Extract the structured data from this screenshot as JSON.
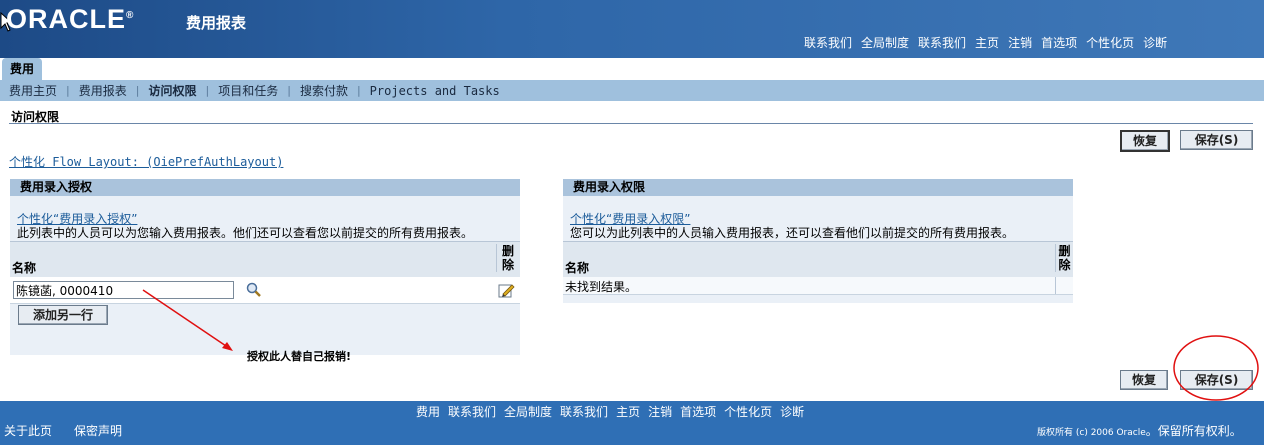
{
  "header": {
    "logo": "ORACLE",
    "app_title": "费用报表",
    "global_links": [
      "联系我们",
      "全局制度",
      "联系我们",
      "主页",
      "注销",
      "首选项",
      "个性化页",
      "诊断"
    ]
  },
  "tabs": {
    "active": "费用"
  },
  "subnav": {
    "items": [
      "费用主页",
      "费用报表",
      "访问权限",
      "项目和任务",
      "搜索付款",
      "Projects and Tasks"
    ],
    "active_index": 2
  },
  "page": {
    "title": "访问权限",
    "revert_label": "恢复",
    "save_label": "保存(S)",
    "personalize_flow": "个性化 Flow Layout: (OiePrefAuthLayout)"
  },
  "left_panel": {
    "title": "费用录入授权",
    "personalize_link": "个性化“费用录入授权”",
    "description": "此列表中的人员可以为您输入费用报表。他们还可以查看您以前提交的所有费用报表。",
    "col_name": "名称",
    "col_delete": "删除",
    "row_value": "陈镜菡, 0000410",
    "add_row_label": "添加另一行"
  },
  "right_panel": {
    "title": "费用录入权限",
    "personalize_link": "个性化“费用录入权限”",
    "description": "您可以为此列表中的人员输入费用报表，还可以查看他们以前提交的所有费用报表。",
    "col_name": "名称",
    "col_delete": "删除",
    "empty_text": "未找到结果。"
  },
  "annotation": {
    "text": "授权此人替自己报销!",
    "color": "#e01010"
  },
  "footer": {
    "links": [
      "费用",
      "联系我们",
      "全局制度",
      "联系我们",
      "主页",
      "注销",
      "首选项",
      "个性化页",
      "诊断"
    ],
    "about": "关于此页",
    "privacy": "保密声明",
    "copyright_small": "版权所有 (c) 2006 Oracle",
    "copyright_rest": "。保留所有权利。"
  },
  "colors": {
    "header": "#2e66a8",
    "tab": "#9fc0dd",
    "footer": "#2f6fb5",
    "link": "#1c5c9a"
  }
}
